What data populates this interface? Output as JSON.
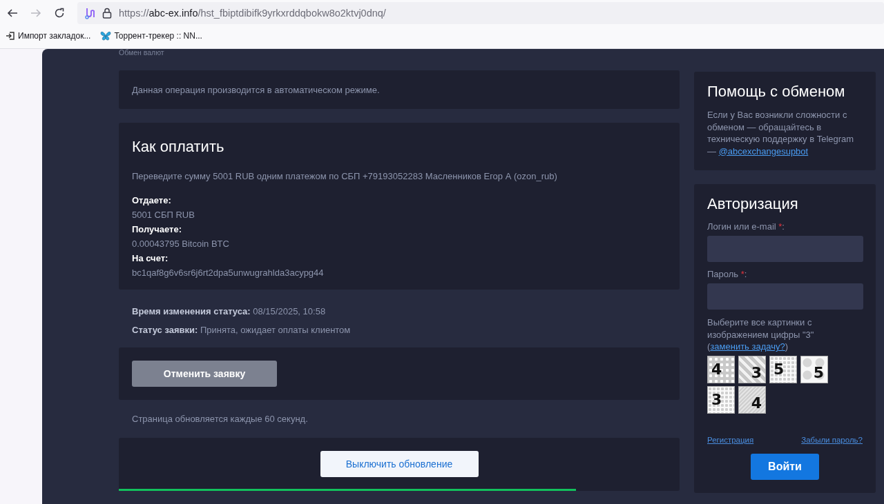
{
  "browser": {
    "back_disabled": false,
    "forward_disabled": true,
    "url": {
      "scheme": "https://",
      "host": "abc-ex.info",
      "path": "/hst_fbiptdibifk9yrkxrddqbokw8o2ktvj0dnq/"
    },
    "bookmarks": [
      {
        "kind": "import",
        "label": "Импорт закладок..."
      },
      {
        "kind": "butterfly",
        "label": "Торрент-трекер :: NN..."
      }
    ]
  },
  "breadcrumb": "Обмен валют",
  "notice": "Данная операция производится в автоматическом режиме.",
  "payment": {
    "title": "Как оплатить",
    "instruction": "Переведите сумму 5001 RUB одним платежом по СБП +79193052283 Масленников Егор А (ozon_rub)",
    "details": [
      {
        "label": "Отдаете:",
        "value": "5001 СБП RUB"
      },
      {
        "label": "Получаете:",
        "value": "0.00043795 Bitcoin BTC"
      },
      {
        "label": "На счет:",
        "value": "bc1qaf8g6v6sr6j6rt2dpa5unwugrahlda3acypg44"
      }
    ]
  },
  "status_lines": [
    "**Время изменения статуса:** 08/15/2025, 10:58",
    "**Статус заявки:** Принята, ожидает оплаты клиентом"
  ],
  "cancel_button": "Отменить заявку",
  "refresh_note": "Страница обновляется каждые 60 секунд.",
  "refresh_button": "Выключить обновление",
  "refresh_progress": {
    "level": 0.815
  },
  "help": {
    "title": "Помощь с обменом",
    "text": "Если у Вас возникли сложности с обменом — обращайтесь в техническую поддержку в Telegram — ",
    "link": "@abcexchangesupbot"
  },
  "auth": {
    "title": "Авторизация",
    "fields": [
      {
        "label": "Логин или e-mail",
        "required_mark": "*",
        "label_end": ":"
      },
      {
        "label": "Пароль",
        "required_mark": "*",
        "label_end": ":"
      }
    ],
    "captcha": {
      "text": "Выберите все картинки с изображением цифры \"3\" (",
      "link": "заменить задачу?",
      "text_end": ")",
      "tiles": [
        {
          "digit": "4",
          "kind": "dots"
        },
        {
          "digit": "3",
          "kind": "zigzag"
        },
        {
          "digit": "5",
          "kind": "grid"
        },
        {
          "digit": "5",
          "kind": "stars"
        },
        {
          "digit": "3",
          "kind": "grid"
        },
        {
          "digit": "4",
          "kind": "stripes"
        }
      ]
    },
    "register_link": "Регистрация",
    "forgot_link": "Забыли пароль?",
    "login_button": "Войти"
  }
}
